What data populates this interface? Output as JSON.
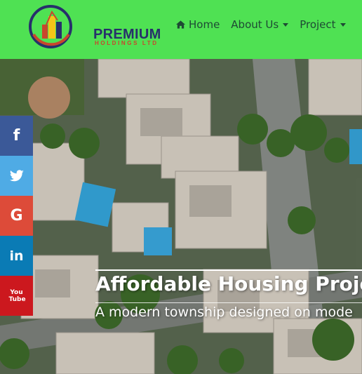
{
  "brand": {
    "name_line1": "PREMIUM",
    "name_line2": "HOLDINGS LTD",
    "colors": {
      "navy": "#27306b",
      "orange": "#c9462c",
      "yellow": "#f5c518"
    }
  },
  "nav": {
    "background": "#4fe153",
    "items": [
      {
        "label": "Home",
        "icon": "home-icon",
        "dropdown": false
      },
      {
        "label": "About Us",
        "dropdown": true
      },
      {
        "label": "Project",
        "dropdown": true
      }
    ]
  },
  "hero": {
    "title": "Affordable Housing Projec",
    "subtitle": "A modern township designed on mode",
    "image": "aerial view of residential houses with pools and trees"
  },
  "social": [
    {
      "icon": "facebook-icon",
      "glyph": "f",
      "color": "#3b5998"
    },
    {
      "icon": "twitter-icon",
      "glyph": "",
      "color": "#4fabe5"
    },
    {
      "icon": "google-icon",
      "glyph": "G",
      "color": "#dd4b39"
    },
    {
      "icon": "linkedin-icon",
      "glyph": "in",
      "color": "#0a7bb5"
    },
    {
      "icon": "youtube-icon",
      "glyph": "You Tube",
      "color": "#cc181e"
    }
  ]
}
